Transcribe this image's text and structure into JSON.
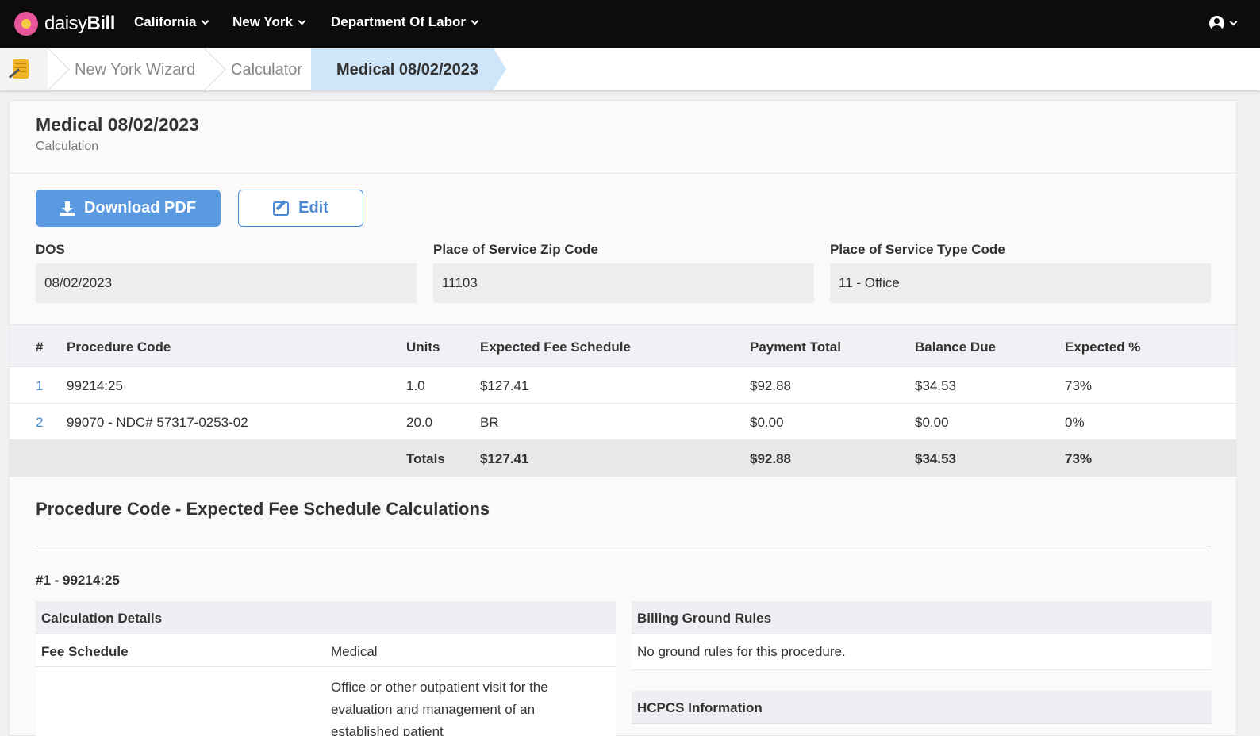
{
  "brand": {
    "name_light": "daisy",
    "name_bold": "Bill"
  },
  "nav": {
    "items": [
      {
        "label": "California"
      },
      {
        "label": "New York"
      },
      {
        "label": "Department Of Labor"
      }
    ]
  },
  "breadcrumb": {
    "items": [
      "New York Wizard",
      "Calculator"
    ],
    "active": "Medical 08/02/2023"
  },
  "page": {
    "title": "Medical 08/02/2023",
    "subtitle": "Calculation"
  },
  "actions": {
    "download_label": "Download PDF",
    "edit_label": "Edit"
  },
  "fields": {
    "dos": {
      "label": "DOS",
      "value": "08/02/2023"
    },
    "zip": {
      "label": "Place of Service Zip Code",
      "value": "11103"
    },
    "type": {
      "label": "Place of Service Type Code",
      "value": "11 - Office"
    }
  },
  "table": {
    "headers": [
      "#",
      "Procedure Code",
      "Units",
      "Expected Fee Schedule",
      "Payment Total",
      "Balance Due",
      "Expected %"
    ],
    "rows": [
      {
        "num": "1",
        "code": "99214:25",
        "units": "1.0",
        "fee": "$127.41",
        "payment": "$92.88",
        "balance": "$34.53",
        "pct": "73%"
      },
      {
        "num": "2",
        "code": "99070 - NDC# 57317-0253-02",
        "units": "20.0",
        "fee": "BR",
        "payment": "$0.00",
        "balance": "$0.00",
        "pct": "0%"
      }
    ],
    "totals": {
      "label": "Totals",
      "fee": "$127.41",
      "payment": "$92.88",
      "balance": "$34.53",
      "pct": "73%"
    }
  },
  "calculations": {
    "section_title": "Procedure Code - Expected Fee Schedule Calculations",
    "procedure_heading": "#1 - 99214:25",
    "details": {
      "title": "Calculation Details",
      "fee_schedule_label": "Fee Schedule",
      "fee_schedule_value": "Medical",
      "description": "Office or other outpatient visit for the evaluation and management of an established patient"
    },
    "ground_rules": {
      "title": "Billing Ground Rules",
      "text": "No ground rules for this procedure."
    },
    "hcpcs": {
      "title": "HCPCS Information"
    }
  },
  "colors": {
    "nav_bg": "#0c0c0c",
    "accent": "#5b9ae0",
    "breadcrumb_active": "#cfe6fa",
    "brand_pink": "#e8559a"
  }
}
